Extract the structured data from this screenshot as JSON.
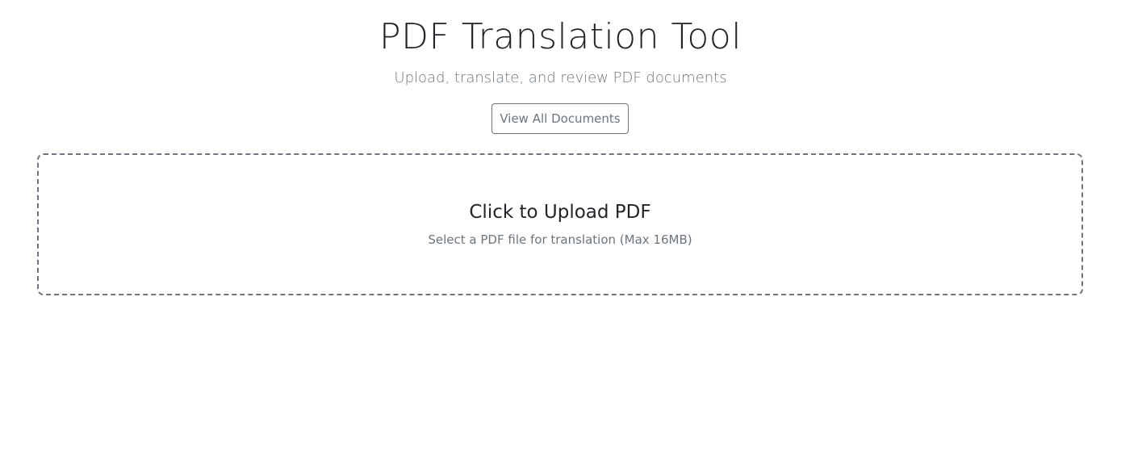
{
  "header": {
    "title": "PDF Translation Tool",
    "subtitle": "Upload, translate, and review PDF documents",
    "view_all_label": "View All Documents"
  },
  "upload": {
    "title": "Click to Upload PDF",
    "hint": "Select a PDF file for translation (Max 16MB)"
  },
  "colors": {
    "text": "#212529",
    "muted": "#6c757d",
    "background": "#ffffff"
  }
}
